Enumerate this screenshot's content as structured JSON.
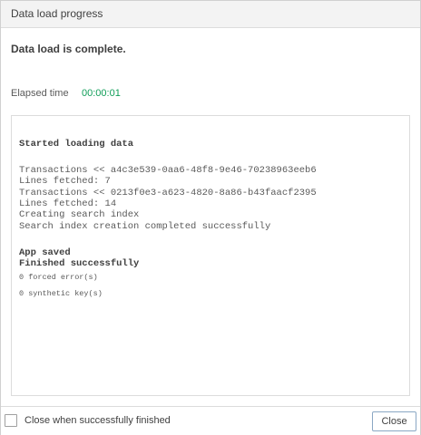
{
  "dialog": {
    "title": "Data load progress",
    "status": "Data load is complete.",
    "elapsed_label": "Elapsed time",
    "elapsed_value": "00:00:01"
  },
  "log": {
    "started": "Started loading data",
    "transactions_1": "Transactions << a4c3e539-0aa6-48f8-9e46-70238963eeb6",
    "lines_fetched_1": "Lines fetched: 7",
    "transactions_2": "Transactions << 0213f0e3-a623-4820-8a86-b43faacf2395",
    "lines_fetched_2": "Lines fetched: 14",
    "creating_index": "Creating search index",
    "index_complete": "Search index creation completed successfully",
    "app_saved": "App saved",
    "finished": "Finished successfully",
    "forced_errors": "0 forced error(s)",
    "synthetic_keys": "0 synthetic key(s)"
  },
  "footer": {
    "checkbox_label": "Close when successfully finished",
    "close_label": "Close"
  },
  "colors": {
    "elapsed_value": "#0f9d58",
    "header_bg": "#f3f3f3",
    "button_border": "#8aa7c4"
  }
}
